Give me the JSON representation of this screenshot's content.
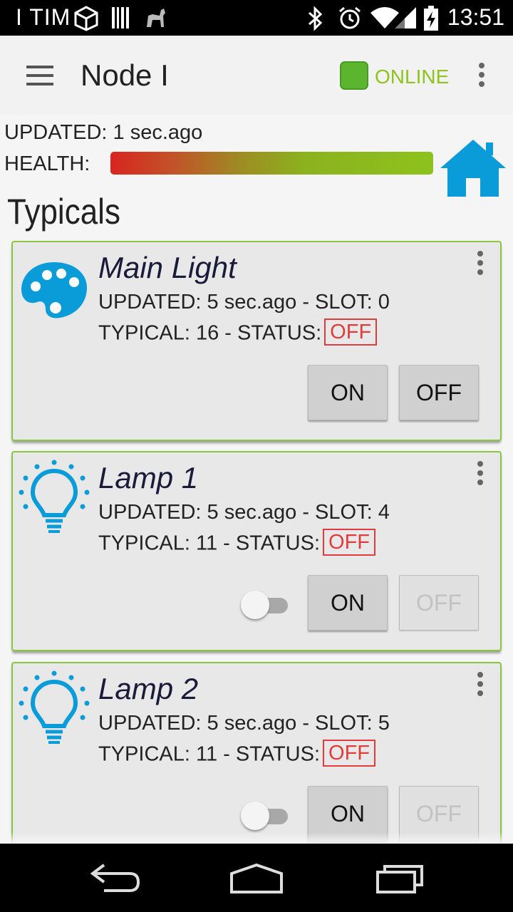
{
  "status_bar": {
    "carrier": "I TIM",
    "time": "13:51",
    "icons": [
      "cube-icon",
      "barcode-icon",
      "cat-icon",
      "bluetooth-icon",
      "alarm-icon",
      "wifi-icon",
      "signal-icon",
      "battery-charging-icon"
    ]
  },
  "app_bar": {
    "title": "Node I",
    "status_label": "ONLINE",
    "status_color": "#5cb52e",
    "icons": [
      "menu-icon",
      "online-indicator",
      "overflow-menu-icon"
    ]
  },
  "info": {
    "updated": "UPDATED: 1 sec.ago",
    "health_label": "HEALTH:",
    "health_colors": [
      "#d8251f",
      "#8dc21d"
    ],
    "home_icon": "home-icon",
    "home_color": "#0a9cd8"
  },
  "section": {
    "title": "Typicals"
  },
  "cards": [
    {
      "name": "Main Light",
      "icon": "palette-icon",
      "updated": "UPDATED: 5 sec.ago - SLOT: 0",
      "typical": "TYPICAL: 16 - STATUS:",
      "status": "OFF",
      "has_toggle": false,
      "on_label": "ON",
      "off_label": "OFF",
      "off_enabled": true
    },
    {
      "name": "Lamp 1",
      "icon": "lightbulb-icon",
      "updated": "UPDATED: 5 sec.ago - SLOT: 4",
      "typical": "TYPICAL: 11 - STATUS:",
      "status": "OFF",
      "has_toggle": true,
      "on_label": "ON",
      "off_label": "OFF",
      "off_enabled": false
    },
    {
      "name": "Lamp 2",
      "icon": "lightbulb-icon",
      "updated": "UPDATED: 5 sec.ago - SLOT: 5",
      "typical": "TYPICAL: 11 - STATUS:",
      "status": "OFF",
      "has_toggle": true,
      "on_label": "ON",
      "off_label": "OFF",
      "off_enabled": false
    }
  ],
  "nav_bar": {
    "icons": [
      "back-icon",
      "home-nav-icon",
      "recents-icon"
    ]
  },
  "colors": {
    "accent": "#8cc63f",
    "icon_blue": "#0a9cd8",
    "status_red": "#e23b3b"
  }
}
